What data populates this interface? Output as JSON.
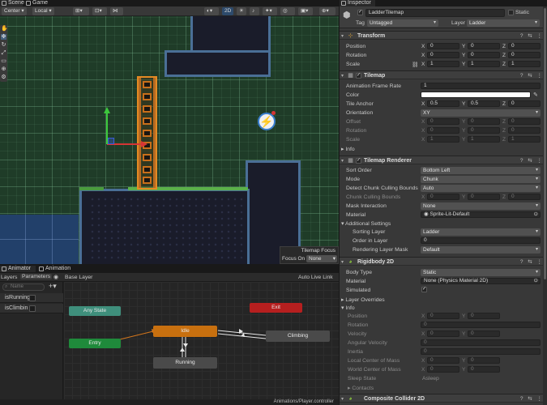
{
  "scene_tabs": {
    "scene": "Scene",
    "game": "Game"
  },
  "scene_toolbar": {
    "center": "Center",
    "local": "Local",
    "mode_2d": "2D"
  },
  "scene_overlay": {
    "title": "Tilemap Focus",
    "focus_label": "Focus On",
    "focus_value": "None"
  },
  "animator": {
    "tab_animator": "Animator",
    "tab_animation": "Animation",
    "layers_tab": "Layers",
    "parameters_tab": "Parameters",
    "base_layer": "Base Layer",
    "auto_live_link": "Auto Live Link",
    "search_placeholder": "Name",
    "params": [
      {
        "name": "isRunning"
      },
      {
        "name": "isClimbin"
      }
    ],
    "nodes": {
      "any_state": "Any State",
      "exit": "Exit",
      "idle": "Idle",
      "entry": "Entry",
      "climbing": "Climbing",
      "running": "Running"
    },
    "controller_path": "Animations/Player.controller"
  },
  "inspector": {
    "tab": "Inspector",
    "object_name": "LadderTilemap",
    "static_label": "Static",
    "tag_label": "Tag",
    "tag_value": "Untagged",
    "layer_label": "Layer",
    "layer_value": "Ladder",
    "transform": {
      "title": "Transform",
      "position_label": "Position",
      "rotation_label": "Rotation",
      "scale_label": "Scale",
      "position": {
        "x": "0",
        "y": "0",
        "z": "0"
      },
      "rotation": {
        "x": "0",
        "y": "0",
        "z": "0"
      },
      "scale": {
        "x": "1",
        "y": "1",
        "z": "1"
      }
    },
    "tilemap": {
      "title": "Tilemap",
      "frame_rate_label": "Animation Frame Rate",
      "frame_rate": "1",
      "color_label": "Color",
      "anchor_label": "Tile Anchor",
      "anchor": {
        "x": "0.5",
        "y": "0.5",
        "z": "0"
      },
      "orientation_label": "Orientation",
      "orientation": "XY",
      "offset_label": "Offset",
      "offset": {
        "x": "0",
        "y": "0",
        "z": "0"
      },
      "rotation_label": "Rotation",
      "rotation": {
        "x": "0",
        "y": "0",
        "z": "0"
      },
      "scale_label": "Scale",
      "scale": {
        "x": "1",
        "y": "1",
        "z": "1"
      },
      "info_label": "Info"
    },
    "renderer": {
      "title": "Tilemap Renderer",
      "sort_order_label": "Sort Order",
      "sort_order": "Bottom Left",
      "mode_label": "Mode",
      "mode": "Chunk",
      "detect_label": "Detect Chunk Culling Bounds",
      "detect": "Auto",
      "culling_label": "Chunk Culling Bounds",
      "culling": {
        "x": "0",
        "y": "0",
        "z": "0"
      },
      "mask_label": "Mask Interaction",
      "mask": "None",
      "material_label": "Material",
      "material": "Sprite-Lit-Default",
      "additional_label": "Additional Settings",
      "sorting_layer_label": "Sorting Layer",
      "sorting_layer": "Ladder",
      "order_label": "Order in Layer",
      "order": "0",
      "rendering_mask_label": "Rendering Layer Mask",
      "rendering_mask": "Default"
    },
    "rigidbody": {
      "title": "Rigidbody 2D",
      "body_type_label": "Body Type",
      "body_type": "Static",
      "material_label": "Material",
      "material": "None (Physics Material 2D)",
      "simulated_label": "Simulated",
      "layer_overrides_label": "Layer Overrides",
      "info_label": "Info",
      "position_label": "Position",
      "position": {
        "x": "0",
        "y": "0"
      },
      "rotation_label": "Rotation",
      "rotation": "0",
      "velocity_label": "Velocity",
      "velocity": {
        "x": "0",
        "y": "0"
      },
      "ang_velocity_label": "Angular Velocity",
      "ang_velocity": "0",
      "inertia_label": "Inertia",
      "inertia": "0",
      "local_com_label": "Local Center of Mass",
      "local_com": {
        "x": "0",
        "y": "0"
      },
      "world_com_label": "World Center of Mass",
      "world_com": {
        "x": "0",
        "y": "0"
      },
      "sleep_label": "Sleep State",
      "sleep": "Asleep",
      "contacts_label": "Contacts"
    },
    "composite": {
      "title": "Composite Collider 2D"
    }
  },
  "icons": {
    "hand": "hand-icon",
    "move": "move-icon",
    "rotate": "rotate-icon",
    "scale": "scale-icon",
    "rect": "rect-icon",
    "transform": "transform-icon",
    "bolt": "lightning-icon",
    "cube": "cube-icon",
    "lock": "lock-icon"
  },
  "colors": {
    "accent": "#2d4a6b",
    "idle_node": "#c8700f",
    "entry_node": "#1f8a3b",
    "any_state_node": "#3f8f7c",
    "exit_node": "#b61f1f",
    "default_node": "#4a4a4a"
  }
}
